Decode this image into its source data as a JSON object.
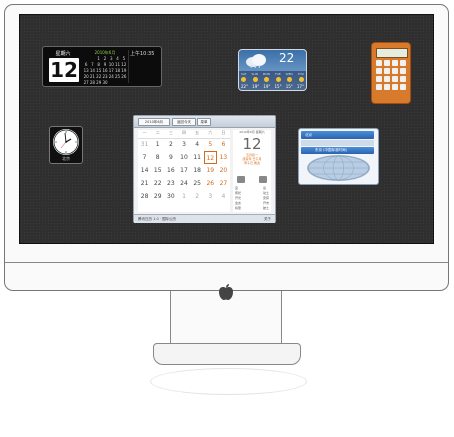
{
  "flip_clock": {
    "weekday": "星期六",
    "day": "12",
    "cal_title": "2010年6月",
    "cal_days": [
      "",
      "",
      "1",
      "2",
      "3",
      "4",
      "5",
      "6",
      "7",
      "8",
      "9",
      "10",
      "11",
      "12",
      "13",
      "14",
      "15",
      "16",
      "17",
      "18",
      "19",
      "20",
      "21",
      "22",
      "23",
      "24",
      "25",
      "26",
      "27",
      "28",
      "29",
      "30",
      "",
      "",
      ""
    ],
    "time": "上午10:35"
  },
  "weather": {
    "current_temp": "22",
    "days": [
      "SAT",
      "SUN",
      "MON",
      "TUE",
      "WED",
      "THU"
    ],
    "temps": [
      "22°",
      "19°",
      "19°",
      "15°",
      "15°",
      "17°"
    ]
  },
  "clock": {
    "city": "北京"
  },
  "calendar": {
    "toolbar": {
      "month_btn": "2010年6月",
      "today_btn": "返回今天",
      "menu_btn": "菜单"
    },
    "weekdays": [
      "一",
      "二",
      "三",
      "四",
      "五",
      "六",
      "日"
    ],
    "weeks": [
      [
        "31",
        "1",
        "2",
        "3",
        "4",
        "5",
        "6"
      ],
      [
        "7",
        "8",
        "9",
        "10",
        "11",
        "12",
        "13"
      ],
      [
        "14",
        "15",
        "16",
        "17",
        "18",
        "19",
        "20"
      ],
      [
        "21",
        "22",
        "23",
        "24",
        "25",
        "26",
        "27"
      ],
      [
        "28",
        "29",
        "30",
        "1",
        "2",
        "3",
        "4"
      ]
    ],
    "side": {
      "header": "2010年6月 星期六",
      "day": "12",
      "lines": [
        "五月初一",
        "庚寅年 壬午月",
        "甲子日 属虎"
      ],
      "col_left": [
        "宜",
        "祭祀",
        "开光",
        "会友",
        "嫁娶"
      ],
      "col_right": [
        "忌",
        "动土",
        "安葬",
        "开市",
        "破土"
      ]
    },
    "status": "腾讯日历 1.0 · 国际公历",
    "status_right": "关于"
  },
  "world_clock": {
    "city1": "北京",
    "city2": "东京 (中国标准时间)"
  },
  "colors": {
    "accent": "#d46a1a",
    "screen": "#2f2f2f"
  }
}
